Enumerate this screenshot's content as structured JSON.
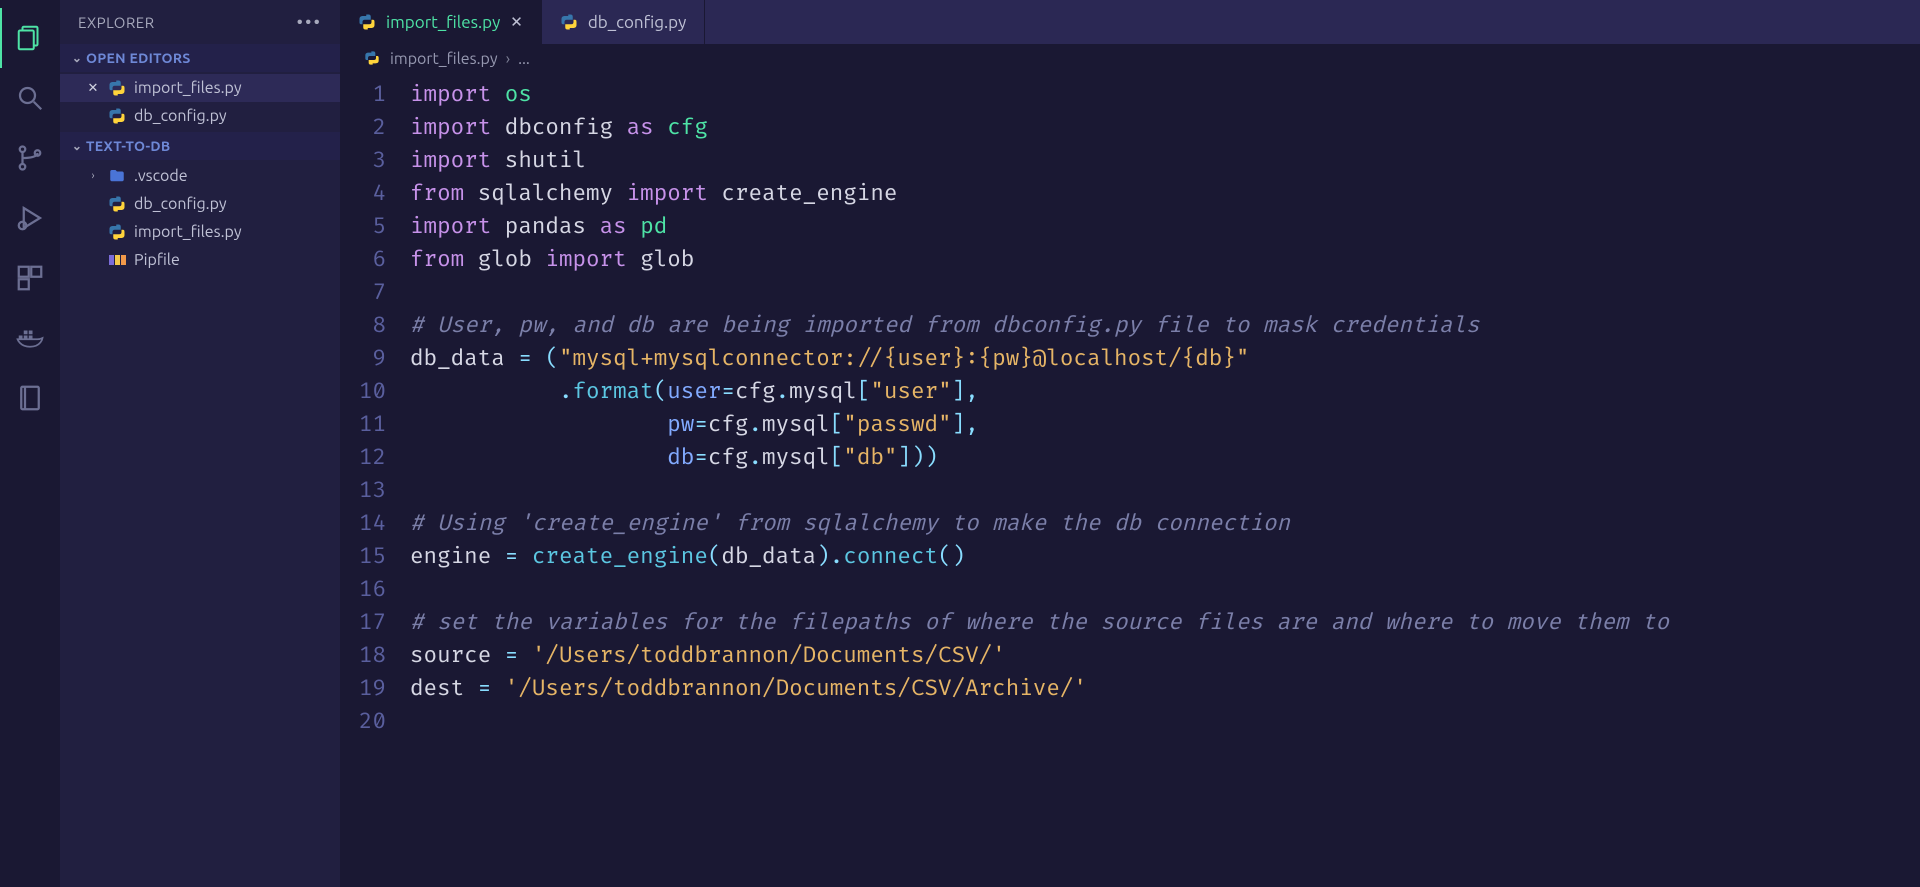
{
  "sidebar": {
    "title": "EXPLORER",
    "sections": {
      "openEditors": {
        "label": "OPEN EDITORS",
        "items": [
          {
            "name": "import_files.py",
            "icon": "python",
            "active": true,
            "close": true
          },
          {
            "name": "db_config.py",
            "icon": "python",
            "active": false,
            "close": false
          }
        ]
      },
      "project": {
        "label": "TEXT-TO-DB",
        "items": [
          {
            "name": ".vscode",
            "icon": "folder",
            "chev": ">"
          },
          {
            "name": "db_config.py",
            "icon": "python"
          },
          {
            "name": "import_files.py",
            "icon": "python"
          },
          {
            "name": "Pipfile",
            "icon": "pip"
          }
        ]
      }
    }
  },
  "tabs": [
    {
      "name": "import_files.py",
      "icon": "python",
      "active": true,
      "closeVisible": true
    },
    {
      "name": "db_config.py",
      "icon": "python",
      "active": false,
      "closeVisible": false
    }
  ],
  "breadcrumb": {
    "file": "import_files.py",
    "trail": "..."
  },
  "code": {
    "lines": [
      [
        [
          "kw",
          "import"
        ],
        [
          "sp",
          " "
        ],
        [
          "py",
          "os"
        ]
      ],
      [
        [
          "kw",
          "import"
        ],
        [
          "sp",
          " "
        ],
        [
          "mod",
          "dbconfig"
        ],
        [
          "sp",
          " "
        ],
        [
          "kw",
          "as"
        ],
        [
          "sp",
          " "
        ],
        [
          "py",
          "cfg"
        ]
      ],
      [
        [
          "kw",
          "import"
        ],
        [
          "sp",
          " "
        ],
        [
          "mod",
          "shutil"
        ]
      ],
      [
        [
          "kw",
          "from"
        ],
        [
          "sp",
          " "
        ],
        [
          "mod",
          "sqlalchemy"
        ],
        [
          "sp",
          " "
        ],
        [
          "kw",
          "import"
        ],
        [
          "sp",
          " "
        ],
        [
          "mod",
          "create_engine"
        ]
      ],
      [
        [
          "kw",
          "import"
        ],
        [
          "sp",
          " "
        ],
        [
          "mod",
          "pandas"
        ],
        [
          "sp",
          " "
        ],
        [
          "kw",
          "as"
        ],
        [
          "sp",
          " "
        ],
        [
          "py",
          "pd"
        ]
      ],
      [
        [
          "kw",
          "from"
        ],
        [
          "sp",
          " "
        ],
        [
          "mod",
          "glob"
        ],
        [
          "sp",
          " "
        ],
        [
          "kw",
          "import"
        ],
        [
          "sp",
          " "
        ],
        [
          "mod",
          "glob"
        ]
      ],
      [],
      [
        [
          "cmt",
          "# User, pw, and db are being imported from dbconfig.py file to mask credentials"
        ]
      ],
      [
        [
          "mod",
          "db_data"
        ],
        [
          "sp",
          " "
        ],
        [
          "op",
          "="
        ],
        [
          "sp",
          " "
        ],
        [
          "op",
          "("
        ],
        [
          "str",
          "\"mysql+mysqlconnector://{user}:{pw}@localhost/{db}\""
        ]
      ],
      [
        [
          "sp",
          "           "
        ],
        [
          "op",
          "."
        ],
        [
          "fn",
          "format"
        ],
        [
          "op",
          "("
        ],
        [
          "var",
          "user"
        ],
        [
          "op",
          "="
        ],
        [
          "mod",
          "cfg"
        ],
        [
          "op",
          "."
        ],
        [
          "mod",
          "mysql"
        ],
        [
          "op",
          "["
        ],
        [
          "str",
          "\"user\""
        ],
        [
          "op",
          "],"
        ]
      ],
      [
        [
          "sp",
          "                   "
        ],
        [
          "var",
          "pw"
        ],
        [
          "op",
          "="
        ],
        [
          "mod",
          "cfg"
        ],
        [
          "op",
          "."
        ],
        [
          "mod",
          "mysql"
        ],
        [
          "op",
          "["
        ],
        [
          "str",
          "\"passwd\""
        ],
        [
          "op",
          "],"
        ]
      ],
      [
        [
          "sp",
          "                   "
        ],
        [
          "var",
          "db"
        ],
        [
          "op",
          "="
        ],
        [
          "mod",
          "cfg"
        ],
        [
          "op",
          "."
        ],
        [
          "mod",
          "mysql"
        ],
        [
          "op",
          "["
        ],
        [
          "str",
          "\"db\""
        ],
        [
          "op",
          "]))"
        ]
      ],
      [],
      [
        [
          "cmt",
          "# Using 'create_engine' from sqlalchemy to make the db connection"
        ]
      ],
      [
        [
          "mod",
          "engine"
        ],
        [
          "sp",
          " "
        ],
        [
          "op",
          "="
        ],
        [
          "sp",
          " "
        ],
        [
          "fn",
          "create_engine"
        ],
        [
          "op",
          "("
        ],
        [
          "mod",
          "db_data"
        ],
        [
          "op",
          ")."
        ],
        [
          "fn",
          "connect"
        ],
        [
          "op",
          "()"
        ]
      ],
      [],
      [
        [
          "cmt",
          "# set the variables for the filepaths of where the source files are and where to move them to"
        ]
      ],
      [
        [
          "mod",
          "source"
        ],
        [
          "sp",
          " "
        ],
        [
          "op",
          "="
        ],
        [
          "sp",
          " "
        ],
        [
          "str",
          "'/Users/toddbrannon/Documents/CSV/'"
        ]
      ],
      [
        [
          "mod",
          "dest"
        ],
        [
          "sp",
          " "
        ],
        [
          "op",
          "="
        ],
        [
          "sp",
          " "
        ],
        [
          "str",
          "'/Users/toddbrannon/Documents/CSV/Archive/'"
        ]
      ],
      []
    ]
  },
  "colors": {
    "accent": "#4ee3a6",
    "bg": "#1a1833",
    "sidebar": "#211f40",
    "tabbar": "#2b2854"
  }
}
